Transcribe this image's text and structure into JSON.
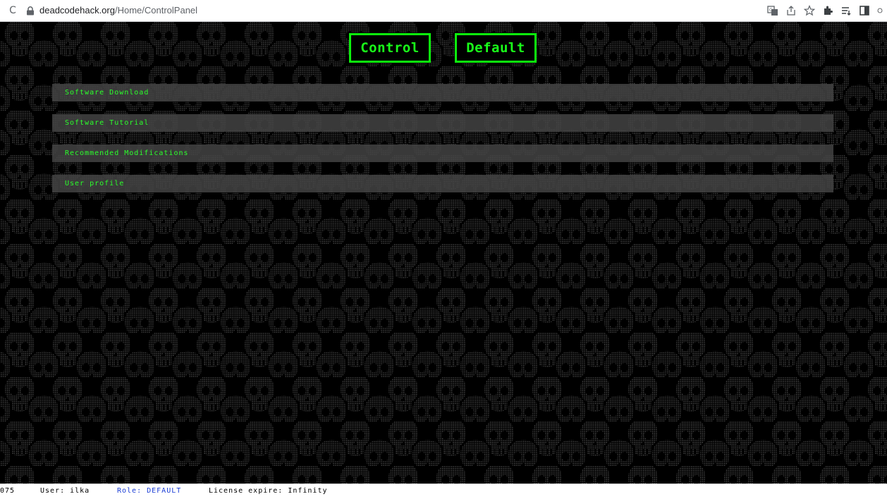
{
  "browser": {
    "url_domain": "deadcodehack.org",
    "url_path": "/Home/ControlPanel",
    "reload_glyph": "C"
  },
  "header": {
    "control_label": "Control",
    "default_label": "Default"
  },
  "menu": {
    "items": [
      {
        "label": "Software Download"
      },
      {
        "label": "Software Tutorial"
      },
      {
        "label": "Recommended Modifications"
      },
      {
        "label": "User profile"
      }
    ]
  },
  "status": {
    "id_fragment": "075",
    "user": "User: ilka",
    "role": "Role: DEFAULT",
    "license": "License expire: Infinity"
  },
  "colors": {
    "accent_green": "#0cf20c",
    "menu_bg": "#464646",
    "role_blue": "#1a3dd6",
    "background": "#000000"
  },
  "icons": [
    "reload-icon",
    "lock-icon",
    "translate-icon",
    "share-icon",
    "star-icon",
    "extensions-icon",
    "reading-list-icon",
    "side-panel-icon",
    "skull-icon"
  ]
}
